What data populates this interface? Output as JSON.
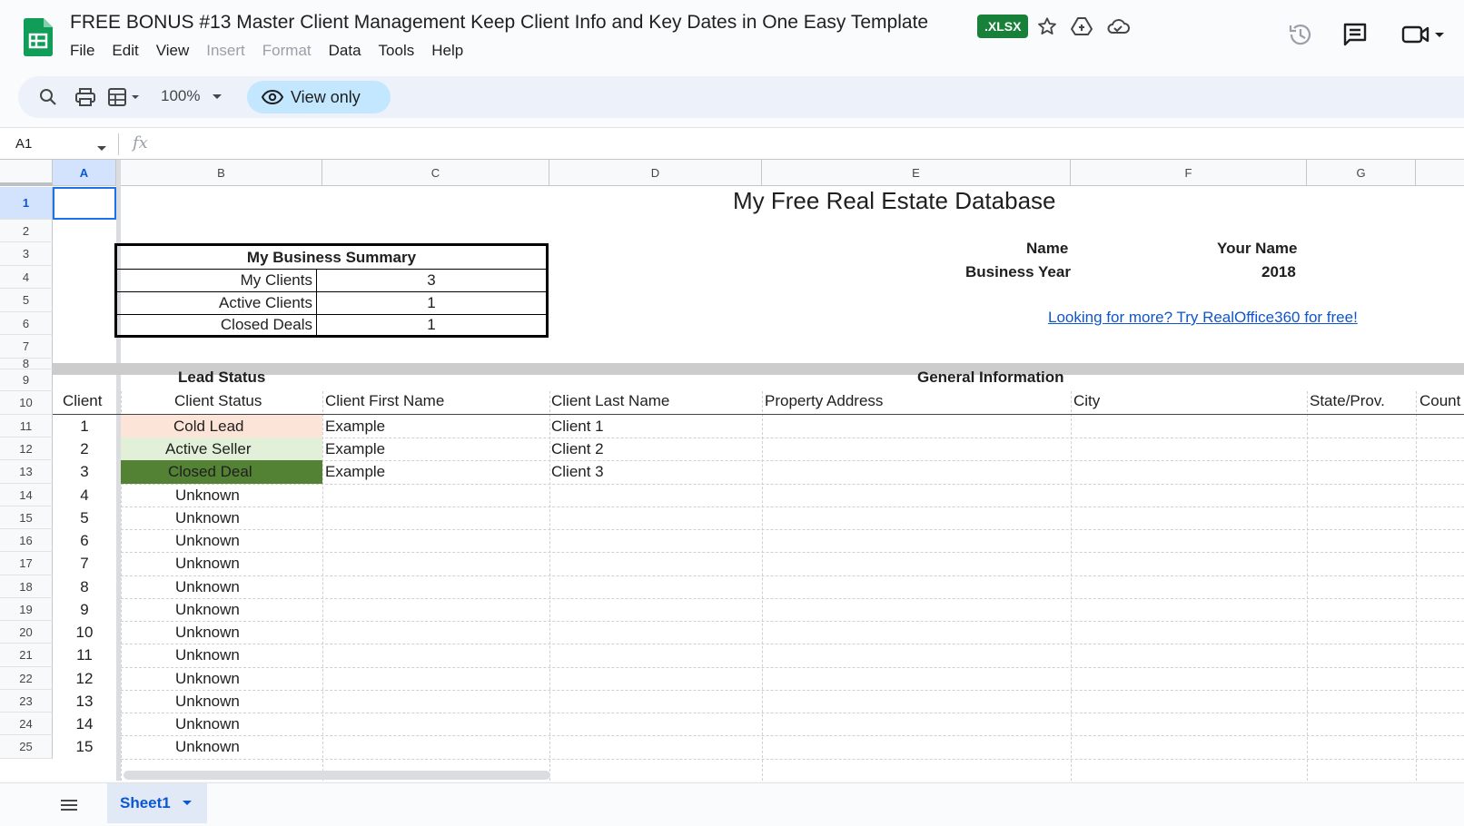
{
  "app": {
    "title": "FREE BONUS #13 Master Client Management Keep Client Info and Key Dates in One Easy Template",
    "badge": ".XLSX",
    "menu": [
      "File",
      "Edit",
      "View",
      "Insert",
      "Format",
      "Data",
      "Tools",
      "Help"
    ],
    "menu_disabled": [
      "Insert",
      "Format"
    ],
    "icons": [
      "star-icon",
      "move-to-drive-icon",
      "cloud-status-icon",
      "version-history-icon",
      "comments-icon",
      "meet-icon"
    ]
  },
  "toolbar": {
    "zoom": "100%",
    "view_only_label": "View only"
  },
  "formula_bar": {
    "name_box": "A1",
    "fx": "fx"
  },
  "columns": [
    "A",
    "B",
    "C",
    "D",
    "E",
    "F",
    "G"
  ],
  "selected_cell": "A1",
  "sheet": {
    "title": "My Free Real Estate Database",
    "summary": {
      "header": "My Business Summary",
      "rows": [
        {
          "label": "My Clients",
          "value": "3"
        },
        {
          "label": "Active Clients",
          "value": "1"
        },
        {
          "label": "Closed Deals",
          "value": "1"
        }
      ]
    },
    "info": {
      "name_label": "Name",
      "name_value": "Your Name",
      "year_label": "Business Year",
      "year_value": "2018",
      "link": "Looking for more? Try RealOffice360 for free!"
    },
    "section_headers": {
      "lead_status": "Lead Status",
      "general_info": "General Information"
    },
    "table_headers": [
      "Client",
      "Client Status",
      "Client First Name",
      "Client Last Name",
      "Property Address",
      "City",
      "State/Prov.",
      "Count"
    ],
    "clients": [
      {
        "num": "1",
        "status": "Cold Lead",
        "first": "Example",
        "last": "Client 1"
      },
      {
        "num": "2",
        "status": "Active Seller",
        "first": "Example",
        "last": "Client 2"
      },
      {
        "num": "3",
        "status": "Closed Deal",
        "first": "Example",
        "last": "Client 3"
      },
      {
        "num": "4",
        "status": "Unknown",
        "first": "",
        "last": ""
      },
      {
        "num": "5",
        "status": "Unknown",
        "first": "",
        "last": ""
      },
      {
        "num": "6",
        "status": "Unknown",
        "first": "",
        "last": ""
      },
      {
        "num": "7",
        "status": "Unknown",
        "first": "",
        "last": ""
      },
      {
        "num": "8",
        "status": "Unknown",
        "first": "",
        "last": ""
      },
      {
        "num": "9",
        "status": "Unknown",
        "first": "",
        "last": ""
      },
      {
        "num": "10",
        "status": "Unknown",
        "first": "",
        "last": ""
      },
      {
        "num": "11",
        "status": "Unknown",
        "first": "",
        "last": ""
      },
      {
        "num": "12",
        "status": "Unknown",
        "first": "",
        "last": ""
      },
      {
        "num": "13",
        "status": "Unknown",
        "first": "",
        "last": ""
      },
      {
        "num": "14",
        "status": "Unknown",
        "first": "",
        "last": ""
      },
      {
        "num": "15",
        "status": "Unknown",
        "first": "",
        "last": ""
      }
    ],
    "status_colors": {
      "Cold Lead": "#fce5d8",
      "Active Seller": "#e2f0d9",
      "Closed Deal": "#548235"
    },
    "row_numbers": [
      "1",
      "2",
      "3",
      "4",
      "5",
      "6",
      "7",
      "8",
      "9",
      "10",
      "11",
      "12",
      "13",
      "14",
      "15",
      "16",
      "17",
      "18",
      "19",
      "20",
      "21",
      "22",
      "23",
      "24",
      "25"
    ]
  },
  "bottom": {
    "sheet_tab": "Sheet1"
  }
}
